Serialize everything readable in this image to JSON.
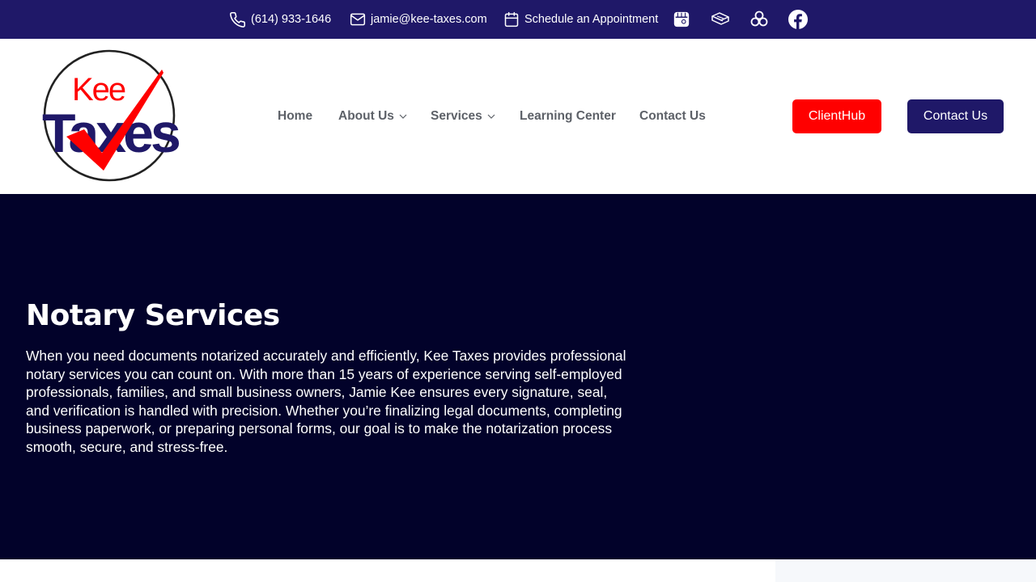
{
  "topbar": {
    "phone": "(614) 933-1646",
    "email": "jamie@kee-taxes.com",
    "schedule": "Schedule an Appointment",
    "icons": [
      "phone-icon",
      "mail-icon",
      "calendar-icon",
      "store-icon",
      "yelp-icon",
      "cloud-icon",
      "facebook-icon"
    ]
  },
  "header": {
    "logo_text_top": "Kee",
    "logo_text_bottom": "Taxes",
    "nav": [
      "Home",
      "About Us",
      "Services",
      "Learning Center",
      "Contact Us"
    ],
    "clienthub_label": "ClientHub",
    "contact_label": "Contact Us"
  },
  "hero": {
    "title": "Notary Services",
    "paragraph": "When you need documents notarized accurately and efficiently, Kee Taxes provides professional notary services you can count on. With more than 15 years of experience serving self-employed professionals, families, and small business owners, Jamie Kee ensures every signature, seal, and verification is handled with precision. Whether you’re finalizing legal documents, completing business paperwork, or preparing personal forms, our goal is to make the notarization process smooth, secure, and stress-free."
  },
  "colors": {
    "topbar_bg": "#1f1868",
    "hero_bg": "#02022a",
    "brand_red": "#ff0000",
    "brand_navy": "#1f1868",
    "nav_text": "#5d6168"
  }
}
